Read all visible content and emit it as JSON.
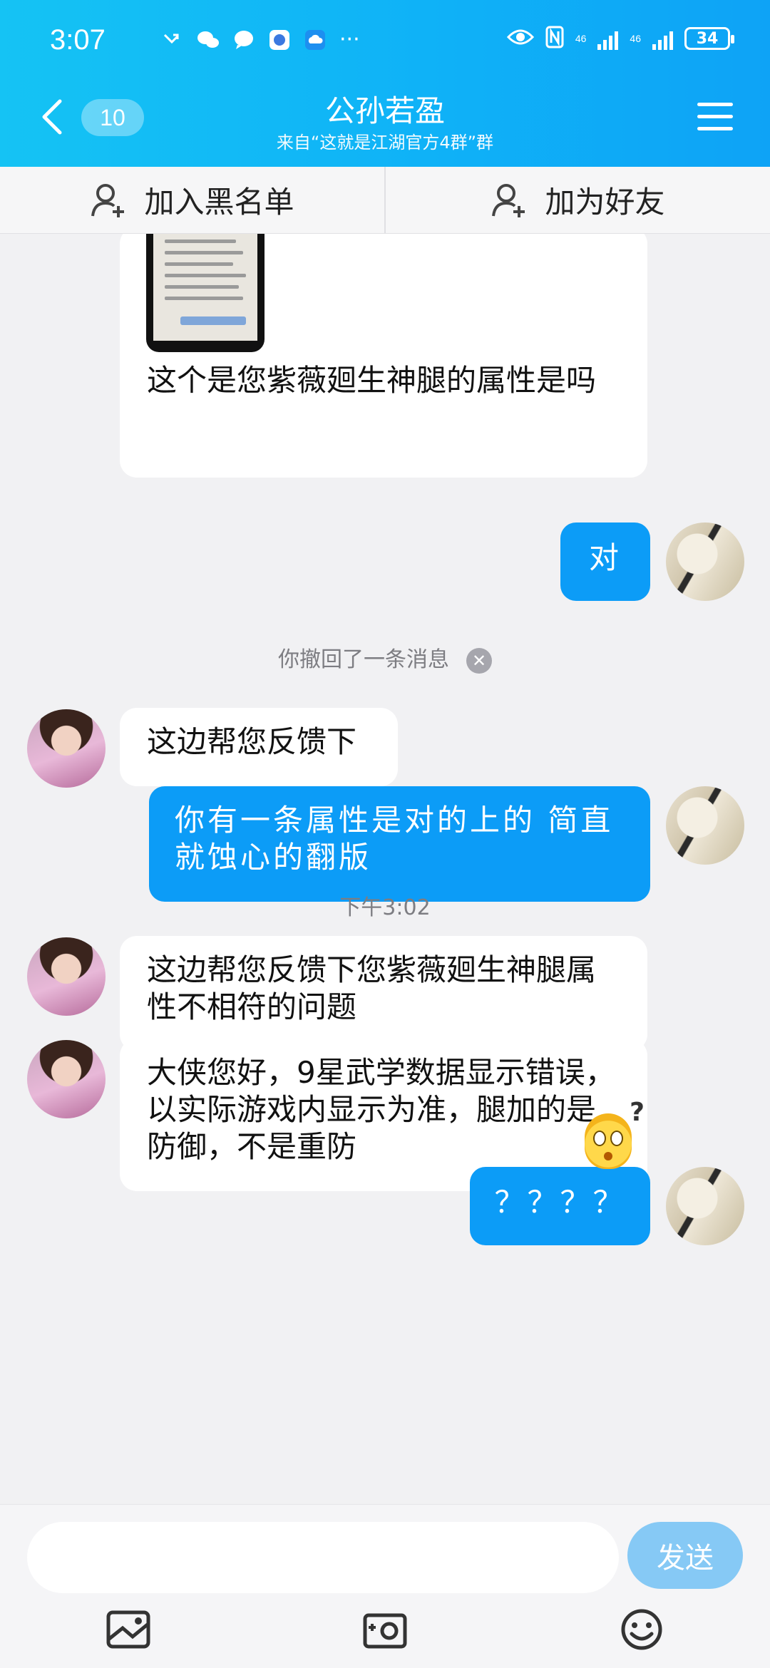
{
  "status_bar": {
    "time": "3:07",
    "dots": "···",
    "net1": "46",
    "net2": "46",
    "battery": "34"
  },
  "header": {
    "unread_count": "10",
    "title": "公孙若盈",
    "subtitle": "来自“这就是江湖官方4群”群",
    "accent_color": "#0fb2f7"
  },
  "actions": {
    "blacklist": "加入黑名单",
    "add_friend": "加为好友"
  },
  "messages": [
    {
      "side": "in",
      "text": "这个是您紫薇廻生神腿的属性是吗"
    },
    {
      "side": "out",
      "text": "对"
    },
    {
      "side": "system",
      "text": "你撤回了一条消息"
    },
    {
      "side": "in",
      "text": "这边帮您反馈下"
    },
    {
      "side": "out",
      "text": "你有一条属性是对的上的  简直就蚀心的翻版"
    },
    {
      "side": "time",
      "text": "下午3:02"
    },
    {
      "side": "in",
      "text": "这边帮您反馈下您紫薇廻生神腿属性不相符的问题"
    },
    {
      "side": "in",
      "text": "大侠您好，9星武学数据显示错误，以实际游戏内显示为准，腿加的是防御，不是重防"
    },
    {
      "side": "out",
      "text": "？？？？"
    }
  ],
  "input": {
    "placeholder": "",
    "send_label": "发送"
  },
  "toolbar_icons": [
    "image-icon",
    "camera-icon",
    "emoji-icon"
  ]
}
